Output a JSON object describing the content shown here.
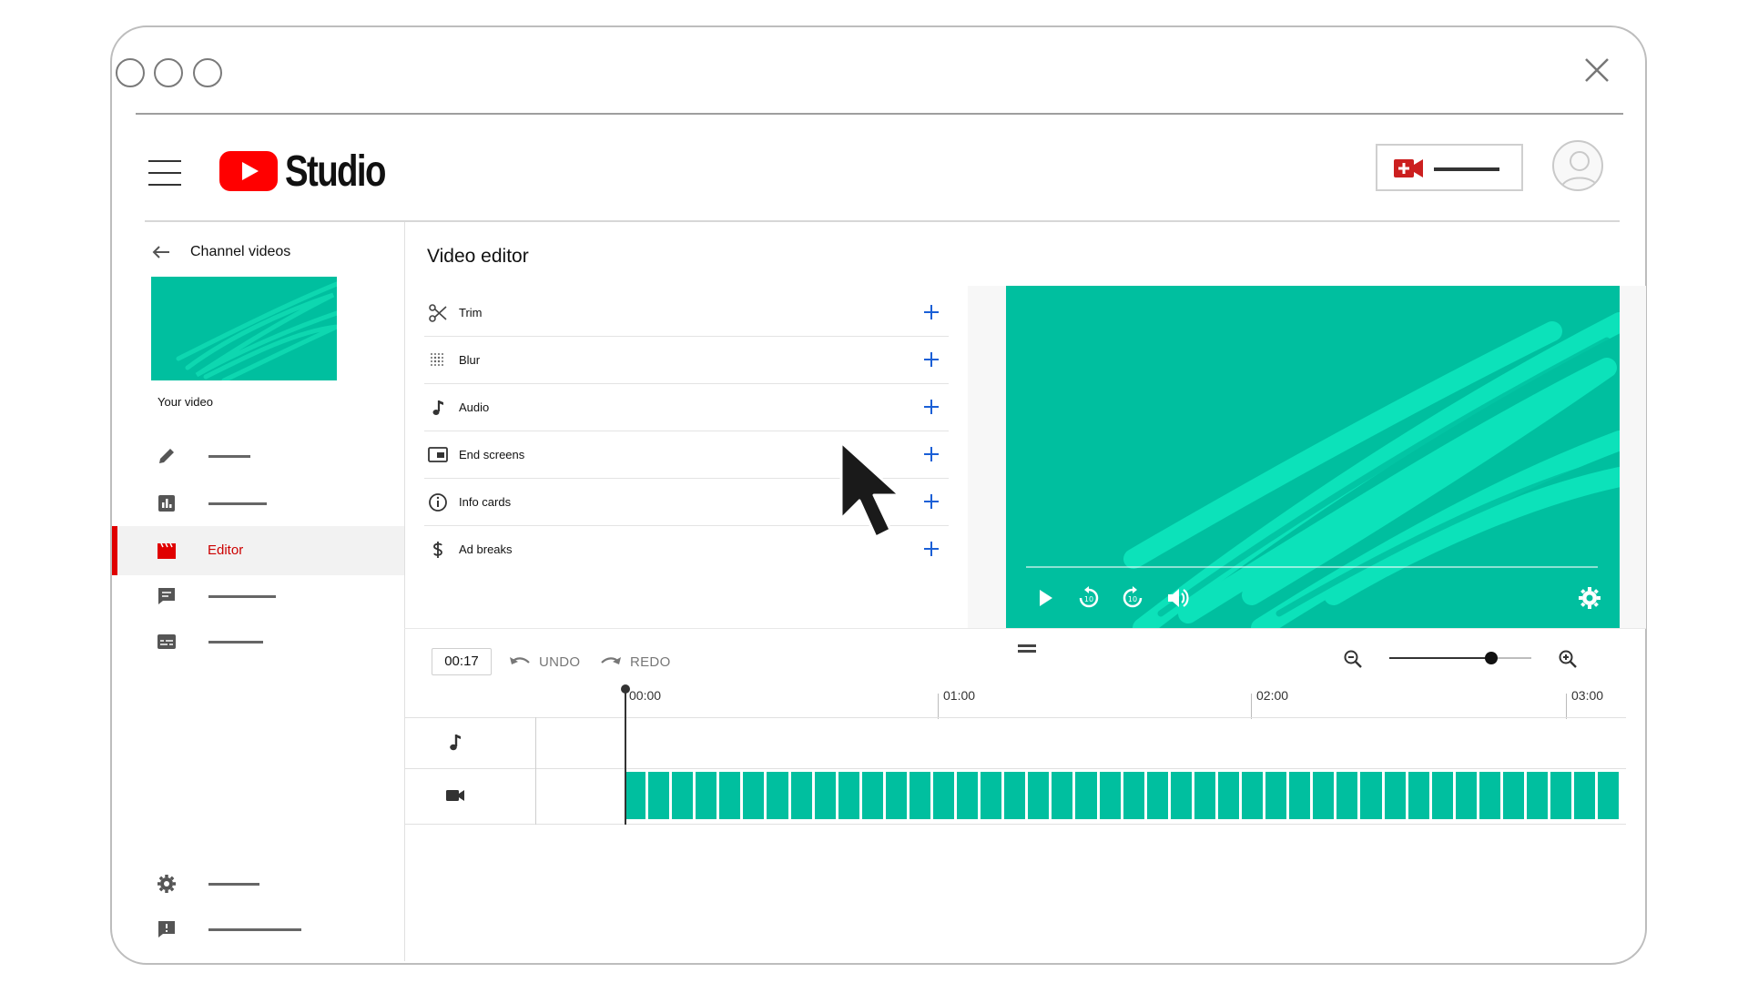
{
  "app": {
    "name": "Studio"
  },
  "nav": {
    "back_label": "Channel videos",
    "video_label": "Your video",
    "active_label": "Editor"
  },
  "editor": {
    "title": "Video editor",
    "tools": [
      {
        "label": "Trim",
        "icon": "scissors-icon"
      },
      {
        "label": "Blur",
        "icon": "blur-icon"
      },
      {
        "label": "Audio",
        "icon": "music-note-icon"
      },
      {
        "label": "End screens",
        "icon": "end-screen-icon"
      },
      {
        "label": "Info cards",
        "icon": "info-icon"
      },
      {
        "label": "Ad breaks",
        "icon": "dollar-icon"
      }
    ]
  },
  "timeline": {
    "current_time": "00:17",
    "undo_label": "UNDO",
    "redo_label": "REDO",
    "ruler": [
      "00:00",
      "01:00",
      "02:00",
      "03:00"
    ],
    "zoom_level": 0.72
  },
  "colors": {
    "accent_red": "#e00000",
    "video_teal": "#00bf9f",
    "scribble_teal": "#00e0b8",
    "link_blue": "#1a5fd6"
  }
}
